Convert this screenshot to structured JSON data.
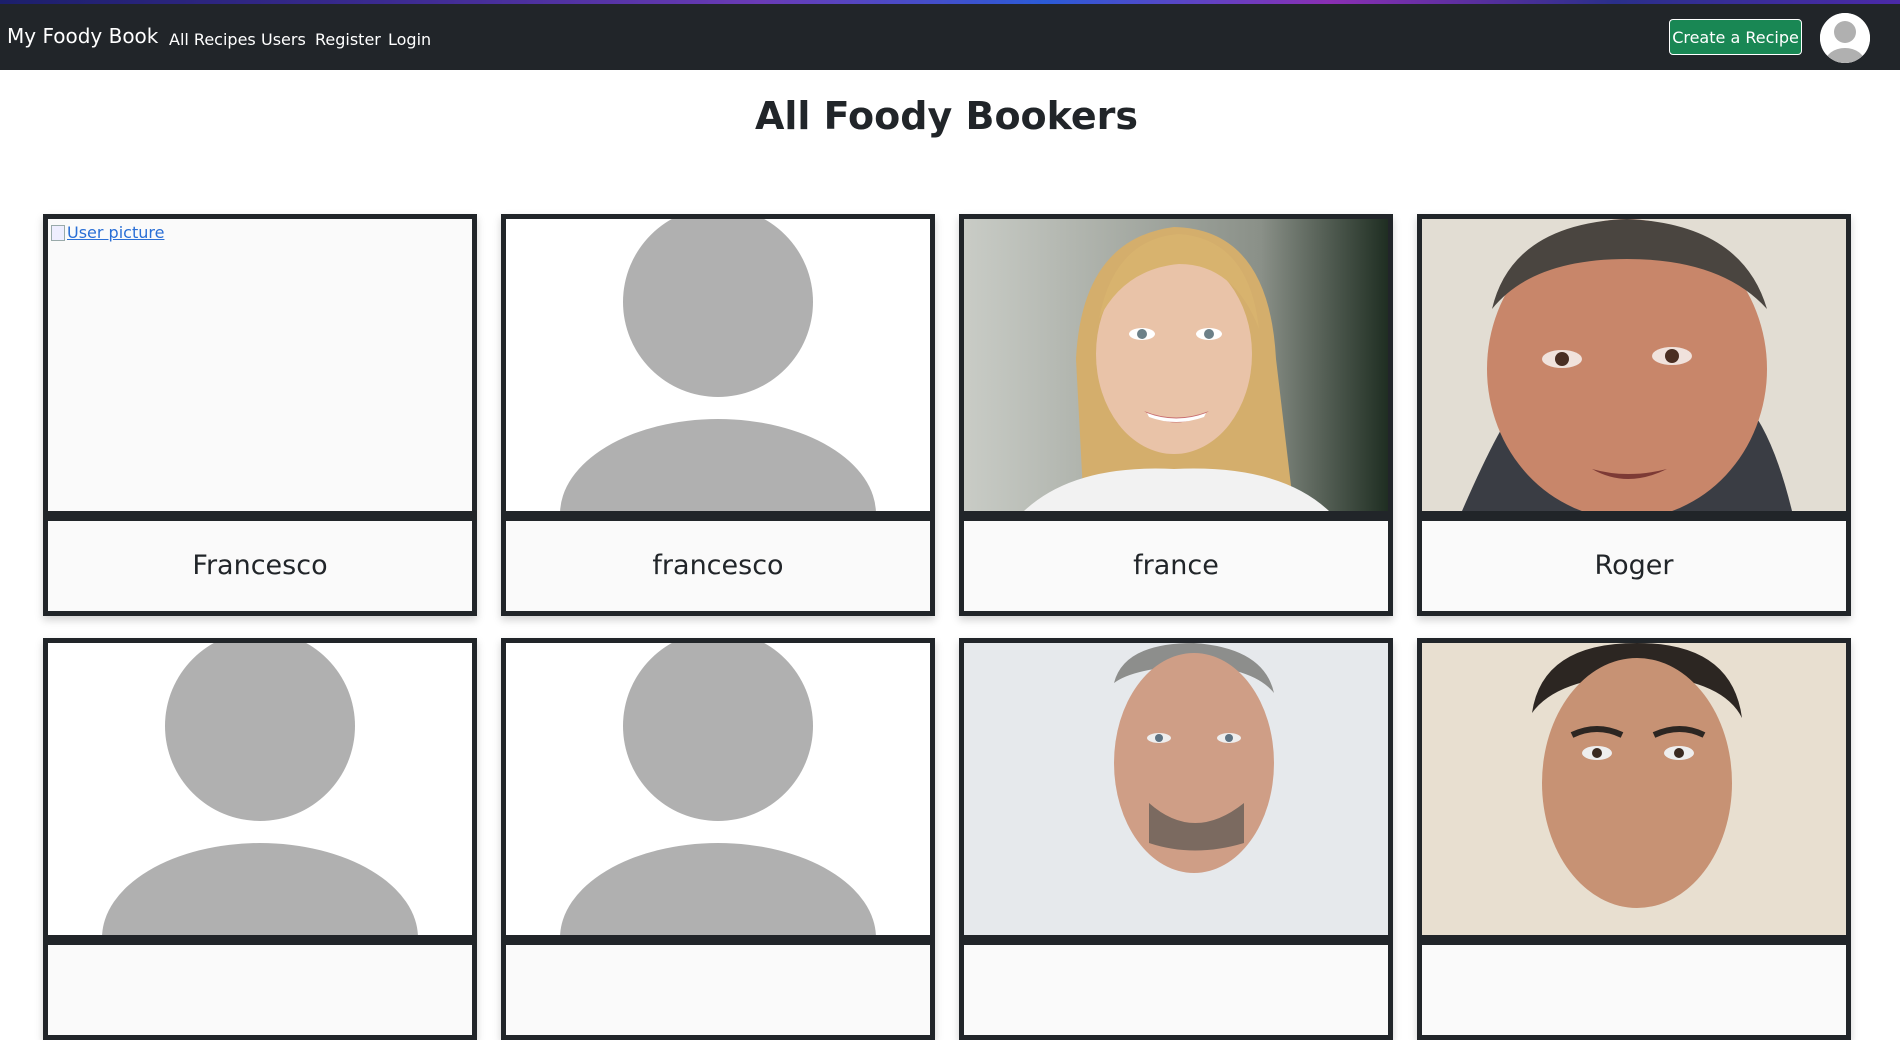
{
  "navbar": {
    "brand": "My Foody Book",
    "links": [
      "All Recipes",
      "Users",
      "Register",
      "Login"
    ],
    "create_button": "Create a Recipe",
    "avatar_icon": "user-avatar-icon"
  },
  "page": {
    "title": "All Foody Bookers"
  },
  "users": [
    {
      "name": "Francesco",
      "picture": "broken-image",
      "alt": "User picture"
    },
    {
      "name": "francesco",
      "picture": "default-avatar"
    },
    {
      "name": "france",
      "picture": "photo-woman-blonde"
    },
    {
      "name": "Roger",
      "picture": "photo-man"
    },
    {
      "name": "",
      "picture": "default-avatar"
    },
    {
      "name": "",
      "picture": "default-avatar"
    },
    {
      "name": "",
      "picture": "photo-man-grey-hair"
    },
    {
      "name": "",
      "picture": "photo-man-dark-hair"
    }
  ],
  "colors": {
    "navbar_bg": "#212529",
    "create_button_bg": "#198754",
    "card_border": "#212529",
    "placeholder_grey": "#b0b0b0"
  }
}
